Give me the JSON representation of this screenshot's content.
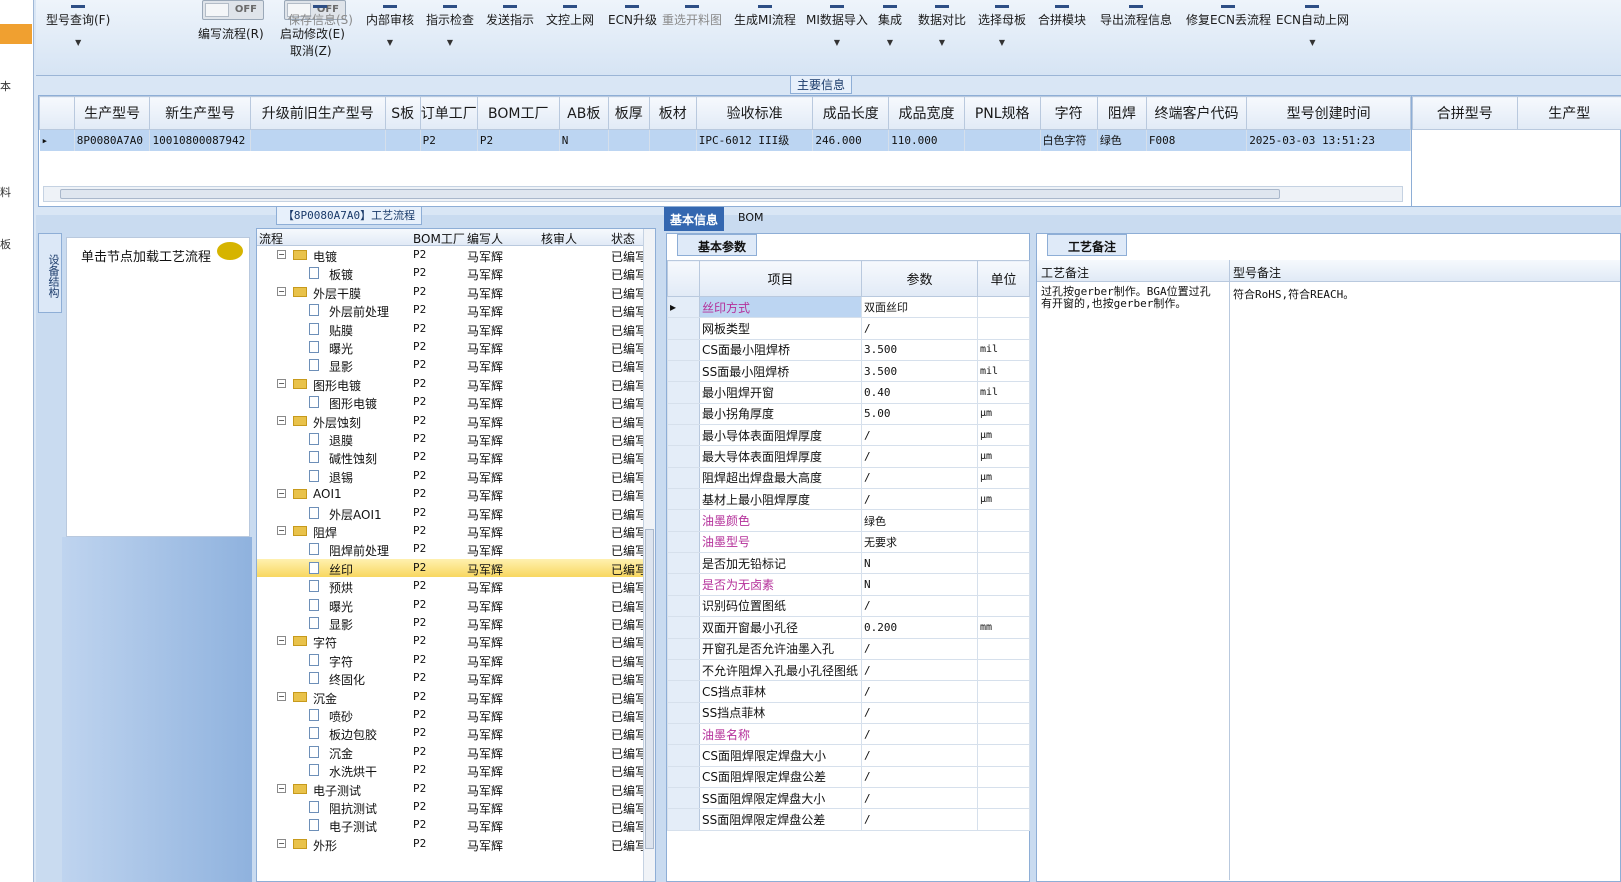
{
  "sidebar": {
    "chars": [
      "本",
      "料",
      "板"
    ]
  },
  "toolbar": {
    "items": [
      {
        "label": "型号查询(F)",
        "icon": "search-icon",
        "has_dropdown": true,
        "disabled": false
      },
      {
        "label": "编写流程(R)",
        "icon": "toggle",
        "disabled": false
      },
      {
        "label": "启动修改(E)",
        "label2": "取消(Z)",
        "icon": "toggle",
        "disabled": false
      },
      {
        "label": "保存信息(S)",
        "icon": "save-icon",
        "disabled": true
      },
      {
        "label": "内部审核",
        "icon": "review-icon",
        "has_dropdown": true,
        "disabled": false
      },
      {
        "label": "指示检查",
        "icon": "check-icon",
        "has_dropdown": true,
        "disabled": false
      },
      {
        "label": "发送指示",
        "icon": "send-icon",
        "disabled": false
      },
      {
        "label": "文控上网",
        "icon": "upload-icon",
        "disabled": false
      },
      {
        "label": "ECN升级",
        "icon": "upgrade-icon",
        "disabled": false
      },
      {
        "label": "重选开料图",
        "icon": "image-icon",
        "disabled": true
      },
      {
        "label": "生成MI流程",
        "icon": "generate-icon",
        "disabled": false
      },
      {
        "label": "MI数据导入",
        "icon": "import-icon",
        "has_dropdown": true,
        "disabled": false
      },
      {
        "label": "集成",
        "icon": "integrate-icon",
        "has_dropdown": true,
        "disabled": false
      },
      {
        "label": "数据对比",
        "icon": "compare-icon",
        "has_dropdown": true,
        "disabled": false
      },
      {
        "label": "选择母板",
        "icon": "board-icon",
        "has_dropdown": true,
        "disabled": false
      },
      {
        "label": "合拼模块",
        "icon": "merge-icon",
        "disabled": false
      },
      {
        "label": "导出流程信息",
        "icon": "export-icon",
        "disabled": false
      },
      {
        "label": "修复ECN丢流程",
        "icon": "repair-icon",
        "disabled": false
      },
      {
        "label": "ECN自动上网",
        "icon": "auto-upload-icon",
        "has_dropdown": true,
        "disabled": false
      }
    ],
    "toggle_off_text": "OFF"
  },
  "main_section": {
    "title": "主要信息",
    "columns": [
      "生产型号",
      "新生产型号",
      "升级前旧生产型号",
      "S板",
      "订单工厂",
      "BOM工厂",
      "AB板",
      "板厚",
      "板材",
      "验收标准",
      "成品长度",
      "成品宽度",
      "PNL规格",
      "字符",
      "阻焊",
      "终端客户代码",
      "型号创建时间"
    ],
    "row": [
      "8P0080A7A0",
      "10010800087942",
      "",
      "",
      "P2",
      "P2",
      "N",
      "",
      "",
      "IPC-6012 III级",
      "246.000",
      "110.000",
      "",
      "白色字符",
      "绿色",
      "F008",
      "2025-03-03 13:51:23"
    ],
    "right_columns": [
      "合拼型号",
      "生产型"
    ]
  },
  "flow_section": {
    "title": "【8P0080A7A0】工艺流程",
    "vertical_tab": "设备结构",
    "node_hint": "单击节点加载工艺流程",
    "columns": [
      "流程",
      "BOM工厂",
      "编写人",
      "核审人",
      "状态"
    ],
    "rows": [
      {
        "name": "电镀",
        "level": 0,
        "factory": "P2",
        "writer": "马军辉",
        "status": "已编写"
      },
      {
        "name": "板镀",
        "level": 1,
        "factory": "P2",
        "writer": "马军辉",
        "status": "已编写"
      },
      {
        "name": "外层干膜",
        "level": 0,
        "factory": "P2",
        "writer": "马军辉",
        "status": "已编写"
      },
      {
        "name": "外层前处理",
        "level": 1,
        "factory": "P2",
        "writer": "马军辉",
        "status": "已编写"
      },
      {
        "name": "贴膜",
        "level": 1,
        "factory": "P2",
        "writer": "马军辉",
        "status": "已编写"
      },
      {
        "name": "曝光",
        "level": 1,
        "factory": "P2",
        "writer": "马军辉",
        "status": "已编写"
      },
      {
        "name": "显影",
        "level": 1,
        "factory": "P2",
        "writer": "马军辉",
        "status": "已编写"
      },
      {
        "name": "图形电镀",
        "level": 0,
        "factory": "P2",
        "writer": "马军辉",
        "status": "已编写"
      },
      {
        "name": "图形电镀",
        "level": 1,
        "factory": "P2",
        "writer": "马军辉",
        "status": "已编写"
      },
      {
        "name": "外层蚀刻",
        "level": 0,
        "factory": "P2",
        "writer": "马军辉",
        "status": "已编写"
      },
      {
        "name": "退膜",
        "level": 1,
        "factory": "P2",
        "writer": "马军辉",
        "status": "已编写"
      },
      {
        "name": "碱性蚀刻",
        "level": 1,
        "factory": "P2",
        "writer": "马军辉",
        "status": "已编写"
      },
      {
        "name": "退锡",
        "level": 1,
        "factory": "P2",
        "writer": "马军辉",
        "status": "已编写"
      },
      {
        "name": "AOI1",
        "level": 0,
        "factory": "P2",
        "writer": "马军辉",
        "status": "已编写"
      },
      {
        "name": "外层AOI1",
        "level": 1,
        "factory": "P2",
        "writer": "马军辉",
        "status": "已编写"
      },
      {
        "name": "阻焊",
        "level": 0,
        "factory": "P2",
        "writer": "马军辉",
        "status": "已编写"
      },
      {
        "name": "阻焊前处理",
        "level": 1,
        "factory": "P2",
        "writer": "马军辉",
        "status": "已编写"
      },
      {
        "name": "丝印",
        "level": 1,
        "factory": "P2",
        "writer": "马军辉",
        "status": "已编写",
        "selected": true
      },
      {
        "name": "预烘",
        "level": 1,
        "factory": "P2",
        "writer": "马军辉",
        "status": "已编写"
      },
      {
        "name": "曝光",
        "level": 1,
        "factory": "P2",
        "writer": "马军辉",
        "status": "已编写"
      },
      {
        "name": "显影",
        "level": 1,
        "factory": "P2",
        "writer": "马军辉",
        "status": "已编写"
      },
      {
        "name": "字符",
        "level": 0,
        "factory": "P2",
        "writer": "马军辉",
        "status": "已编写"
      },
      {
        "name": "字符",
        "level": 1,
        "factory": "P2",
        "writer": "马军辉",
        "status": "已编写"
      },
      {
        "name": "终固化",
        "level": 1,
        "factory": "P2",
        "writer": "马军辉",
        "status": "已编写"
      },
      {
        "name": "沉金",
        "level": 0,
        "factory": "P2",
        "writer": "马军辉",
        "status": "已编写"
      },
      {
        "name": "喷砂",
        "level": 1,
        "factory": "P2",
        "writer": "马军辉",
        "status": "已编写"
      },
      {
        "name": "板边包胶",
        "level": 1,
        "factory": "P2",
        "writer": "马军辉",
        "status": "已编写"
      },
      {
        "name": "沉金",
        "level": 1,
        "factory": "P2",
        "writer": "马军辉",
        "status": "已编写"
      },
      {
        "name": "水洗烘干",
        "level": 1,
        "factory": "P2",
        "writer": "马军辉",
        "status": "已编写"
      },
      {
        "name": "电子测试",
        "level": 0,
        "factory": "P2",
        "writer": "马军辉",
        "status": "已编写"
      },
      {
        "name": "阻抗测试",
        "level": 1,
        "factory": "P2",
        "writer": "马军辉",
        "status": "已编写"
      },
      {
        "name": "电子测试",
        "level": 1,
        "factory": "P2",
        "writer": "马军辉",
        "status": "已编写"
      },
      {
        "name": "外形",
        "level": 0,
        "factory": "P2",
        "writer": "马军辉",
        "status": "已编写"
      }
    ]
  },
  "detail_tabs": [
    "基本信息",
    "BOM"
  ],
  "basic_params": {
    "subtab": "基本参数",
    "columns": [
      "项目",
      "参数",
      "单位"
    ],
    "rows": [
      {
        "item": "丝印方式",
        "value": "双面丝印",
        "unit": "",
        "purple": true
      },
      {
        "item": "网板类型",
        "value": "/",
        "unit": ""
      },
      {
        "item": "CS面最小阻焊桥",
        "value": "3.500",
        "unit": "mil"
      },
      {
        "item": "SS面最小阻焊桥",
        "value": "3.500",
        "unit": "mil"
      },
      {
        "item": "最小阻焊开窗",
        "value": "0.40",
        "unit": "mil"
      },
      {
        "item": "最小拐角厚度",
        "value": "5.00",
        "unit": "μm"
      },
      {
        "item": "最小导体表面阻焊厚度",
        "value": "/",
        "unit": "μm"
      },
      {
        "item": "最大导体表面阻焊厚度",
        "value": "/",
        "unit": "μm"
      },
      {
        "item": "阻焊超出焊盘最大高度",
        "value": "/",
        "unit": "μm"
      },
      {
        "item": "基材上最小阻焊厚度",
        "value": "/",
        "unit": "μm"
      },
      {
        "item": "油墨颜色",
        "value": "绿色",
        "unit": "",
        "purple": true
      },
      {
        "item": "油墨型号",
        "value": "无要求",
        "unit": "",
        "purple": true
      },
      {
        "item": "是否加无铅标记",
        "value": "N",
        "unit": ""
      },
      {
        "item": "是否为无卤素",
        "value": "N",
        "unit": "",
        "purple": true
      },
      {
        "item": "识别码位置图纸",
        "value": "/",
        "unit": ""
      },
      {
        "item": "双面开窗最小孔径",
        "value": "0.200",
        "unit": "mm"
      },
      {
        "item": "开窗孔是否允许油墨入孔",
        "value": "/",
        "unit": ""
      },
      {
        "item": "不允许阻焊入孔最小孔径图纸",
        "value": "/",
        "unit": ""
      },
      {
        "item": "CS挡点菲林",
        "value": "/",
        "unit": ""
      },
      {
        "item": "SS挡点菲林",
        "value": "/",
        "unit": ""
      },
      {
        "item": "油墨名称",
        "value": "/",
        "unit": "",
        "purple": true
      },
      {
        "item": "CS面阻焊限定焊盘大小",
        "value": "/",
        "unit": ""
      },
      {
        "item": "CS面阻焊限定焊盘公差",
        "value": "/",
        "unit": ""
      },
      {
        "item": "SS面阻焊限定焊盘大小",
        "value": "/",
        "unit": ""
      },
      {
        "item": "SS面阻焊限定焊盘公差",
        "value": "/",
        "unit": ""
      }
    ]
  },
  "notes": {
    "subtab": "工艺备注",
    "col1": "工艺备注",
    "col2": "型号备注",
    "process_note": "过孔按gerber制作。BGA位置过孔有开窗的,也按gerber制作。",
    "model_note": "符合RoHS,符合REACH。"
  }
}
